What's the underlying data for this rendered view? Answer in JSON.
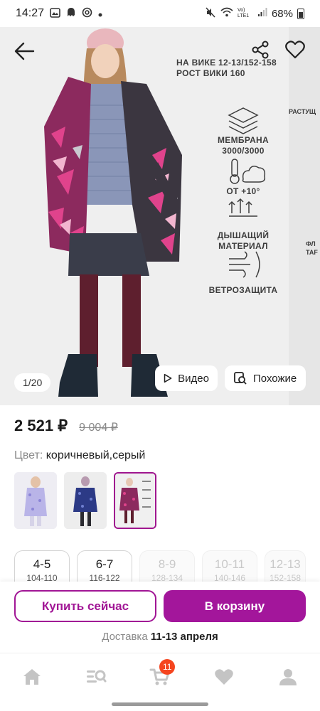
{
  "status_bar": {
    "time": "14:27",
    "battery": "68%",
    "icons": [
      "photo-icon",
      "ghost-icon",
      "at-icon",
      "dot-icon",
      "mute-icon",
      "wifi-icon",
      "volte-icon",
      "signal-icon",
      "battery-icon"
    ],
    "network_label": "Vo) LTE1"
  },
  "gallery": {
    "counter": "1/20",
    "size_note_line1": "НА ВИКЕ 12-13/152-158",
    "size_note_line2": "РОСТ ВИКИ 160",
    "side_note_1": "РАСТУЩ",
    "side_note_2": "ФЛ",
    "side_note_3": "TAF",
    "features": [
      {
        "line1": "МЕМБРАНА",
        "line2": "3000/3000",
        "icon": "membrane-icon"
      },
      {
        "line1": "ОТ +10°",
        "line2": "",
        "icon": "thermometer-cloud-icon"
      },
      {
        "line1": "ДЫШАЩИЙ",
        "line2": "МАТЕРИАЛ",
        "icon": "breathable-icon"
      },
      {
        "line1": "ВЕТРОЗАЩИТА",
        "line2": "",
        "icon": "wind-icon"
      }
    ],
    "video_label": "Видео",
    "similar_label": "Похожие"
  },
  "product": {
    "price": "2 521 ₽",
    "old_price": "9 004 ₽",
    "color_label": "Цвет:",
    "color_value": "коричневый,серый"
  },
  "sizes": [
    {
      "main": "4-5",
      "sub": "104-110",
      "available": true
    },
    {
      "main": "6-7",
      "sub": "116-122",
      "available": true
    },
    {
      "main": "8-9",
      "sub": "128-134",
      "available": false
    },
    {
      "main": "10-11",
      "sub": "140-146",
      "available": false
    },
    {
      "main": "12-13",
      "sub": "152-158",
      "available": false
    }
  ],
  "actions": {
    "buy_now": "Купить сейчас",
    "add_to_cart": "В корзину",
    "delivery_label": "Доставка",
    "delivery_date": "11-13 апреля"
  },
  "nav": {
    "cart_count": "11"
  },
  "colors": {
    "accent": "#a3169b",
    "badge": "#f5451f"
  }
}
